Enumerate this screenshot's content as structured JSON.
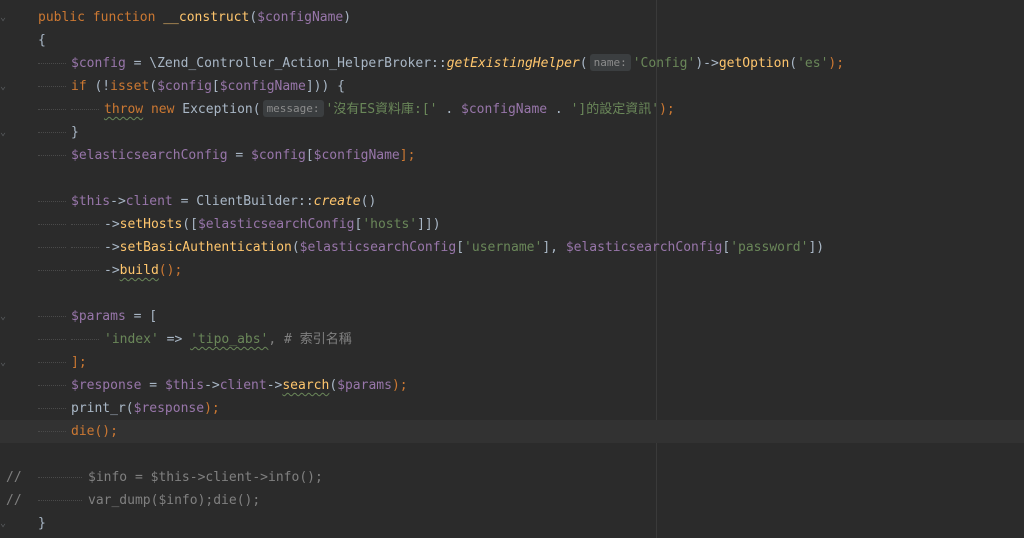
{
  "editor": {
    "lines": [
      {
        "id": "l1",
        "segments": [
          {
            "t": "public function ",
            "c": "kw"
          },
          {
            "t": "__construct",
            "c": "fn"
          },
          {
            "t": "(",
            "c": "txt"
          },
          {
            "t": "$configName",
            "c": "var"
          },
          {
            "t": ")",
            "c": "txt"
          }
        ]
      },
      {
        "id": "l2",
        "segments": [
          {
            "t": "{",
            "c": "txt"
          }
        ]
      },
      {
        "id": "l3",
        "segments": [
          {
            "t": "$config",
            "c": "var"
          },
          {
            "t": " = \\Zend_Controller_Action_HelperBroker::",
            "c": "txt"
          },
          {
            "t": "getExistingHelper",
            "c": "fn it"
          },
          {
            "t": "(",
            "c": "txt"
          },
          {
            "t": "name:",
            "c": "hint"
          },
          {
            "t": "'Config'",
            "c": "str"
          },
          {
            "t": ")->",
            "c": "txt"
          },
          {
            "t": "getOption",
            "c": "fn"
          },
          {
            "t": "(",
            "c": "txt"
          },
          {
            "t": "'es'",
            "c": "str"
          },
          {
            "t": ");",
            "c": "kw"
          }
        ]
      },
      {
        "id": "l4",
        "segments": [
          {
            "t": "if ",
            "c": "kw"
          },
          {
            "t": "(!",
            "c": "txt"
          },
          {
            "t": "isset",
            "c": "kw"
          },
          {
            "t": "(",
            "c": "txt"
          },
          {
            "t": "$config",
            "c": "var"
          },
          {
            "t": "[",
            "c": "txt"
          },
          {
            "t": "$configName",
            "c": "var"
          },
          {
            "t": "])) {",
            "c": "txt"
          }
        ]
      },
      {
        "id": "l5",
        "segments": [
          {
            "t": "throw",
            "c": "kw squig"
          },
          {
            "t": " new ",
            "c": "kw"
          },
          {
            "t": "Exception(",
            "c": "txt"
          },
          {
            "t": "message:",
            "c": "hint"
          },
          {
            "t": "'沒有ES資料庫:[' ",
            "c": "str"
          },
          {
            "t": ". ",
            "c": "txt"
          },
          {
            "t": "$configName",
            "c": "var"
          },
          {
            "t": " . ",
            "c": "txt"
          },
          {
            "t": "']的設定資訊'",
            "c": "str"
          },
          {
            "t": ");",
            "c": "kw"
          }
        ]
      },
      {
        "id": "l6",
        "segments": [
          {
            "t": "}",
            "c": "txt"
          }
        ]
      },
      {
        "id": "l7",
        "segments": [
          {
            "t": "$elasticsearchConfig",
            "c": "var"
          },
          {
            "t": " = ",
            "c": "txt"
          },
          {
            "t": "$config",
            "c": "var"
          },
          {
            "t": "[",
            "c": "txt"
          },
          {
            "t": "$configName",
            "c": "var"
          },
          {
            "t": "];",
            "c": "kw"
          }
        ]
      },
      {
        "id": "l8",
        "segments": []
      },
      {
        "id": "l9",
        "segments": [
          {
            "t": "$this",
            "c": "var"
          },
          {
            "t": "->",
            "c": "txt"
          },
          {
            "t": "client",
            "c": "var"
          },
          {
            "t": " = ClientBuilder::",
            "c": "txt"
          },
          {
            "t": "create",
            "c": "fn it"
          },
          {
            "t": "()",
            "c": "txt"
          }
        ]
      },
      {
        "id": "l10",
        "segments": [
          {
            "t": "->",
            "c": "txt"
          },
          {
            "t": "setHosts",
            "c": "fn"
          },
          {
            "t": "([",
            "c": "txt"
          },
          {
            "t": "$elasticsearchConfig",
            "c": "var"
          },
          {
            "t": "[",
            "c": "txt"
          },
          {
            "t": "'hosts'",
            "c": "str"
          },
          {
            "t": "]])",
            "c": "txt"
          }
        ]
      },
      {
        "id": "l11",
        "segments": [
          {
            "t": "->",
            "c": "txt"
          },
          {
            "t": "setBasicAuthentication",
            "c": "fn"
          },
          {
            "t": "(",
            "c": "txt"
          },
          {
            "t": "$elasticsearchConfig",
            "c": "var"
          },
          {
            "t": "[",
            "c": "txt"
          },
          {
            "t": "'username'",
            "c": "str"
          },
          {
            "t": "], ",
            "c": "txt"
          },
          {
            "t": "$elasticsearchConfig",
            "c": "var"
          },
          {
            "t": "[",
            "c": "txt"
          },
          {
            "t": "'password'",
            "c": "str"
          },
          {
            "t": "])",
            "c": "txt"
          }
        ]
      },
      {
        "id": "l12",
        "segments": [
          {
            "t": "->",
            "c": "txt"
          },
          {
            "t": "build",
            "c": "fn squig"
          },
          {
            "t": "();",
            "c": "kw"
          }
        ]
      },
      {
        "id": "l13",
        "segments": []
      },
      {
        "id": "l14",
        "segments": [
          {
            "t": "$params",
            "c": "var"
          },
          {
            "t": " = [",
            "c": "txt"
          }
        ]
      },
      {
        "id": "l15",
        "segments": [
          {
            "t": "'index'",
            "c": "str"
          },
          {
            "t": " => ",
            "c": "txt"
          },
          {
            "t": "'tipo_abs'",
            "c": "str squig"
          },
          {
            "t": ", # 索引名稱",
            "c": "cmt"
          }
        ]
      },
      {
        "id": "l16",
        "segments": [
          {
            "t": "];",
            "c": "kw"
          }
        ]
      },
      {
        "id": "l17",
        "segments": [
          {
            "t": "$response",
            "c": "var"
          },
          {
            "t": " = ",
            "c": "txt"
          },
          {
            "t": "$this",
            "c": "var"
          },
          {
            "t": "->",
            "c": "txt"
          },
          {
            "t": "client",
            "c": "var"
          },
          {
            "t": "->",
            "c": "txt"
          },
          {
            "t": "search",
            "c": "fn squig"
          },
          {
            "t": "(",
            "c": "txt"
          },
          {
            "t": "$params",
            "c": "var"
          },
          {
            "t": ");",
            "c": "kw"
          }
        ]
      },
      {
        "id": "l18",
        "segments": [
          {
            "t": "print_r(",
            "c": "txt"
          },
          {
            "t": "$response",
            "c": "var"
          },
          {
            "t": ");",
            "c": "kw"
          }
        ]
      },
      {
        "id": "l19",
        "segments": [
          {
            "t": "die",
            "c": "kw"
          },
          {
            "t": "();",
            "c": "kw"
          }
        ]
      },
      {
        "id": "l20",
        "segments": []
      },
      {
        "id": "l21",
        "comment_mark": "//",
        "segments": [
          {
            "t": "$info = $this->client->info();",
            "c": "cmt"
          }
        ]
      },
      {
        "id": "l22",
        "comment_mark": "//",
        "segments": [
          {
            "t": "var_dump($info);die();",
            "c": "cmt"
          }
        ]
      },
      {
        "id": "l23",
        "segments": [
          {
            "t": "}",
            "c": "txt"
          }
        ]
      }
    ]
  }
}
